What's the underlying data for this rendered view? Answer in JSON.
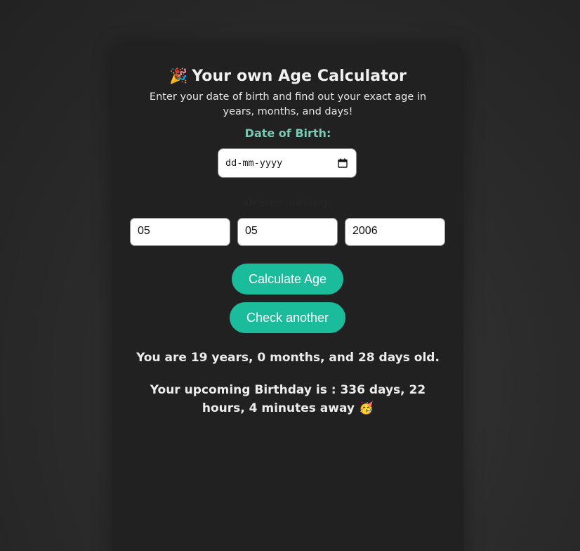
{
  "header": {
    "emoji": "🎉",
    "title": "Your own Age Calculator",
    "subtitle": "Enter your date of birth and find out your exact age in years, months, and days!"
  },
  "dob": {
    "label": "Date of Birth:",
    "placeholder": "dd-mm-yyyy",
    "calendar_icon": "calendar-icon"
  },
  "manual": {
    "label": "Or enter manually:",
    "day": "05",
    "month": "05",
    "year": "2006"
  },
  "buttons": {
    "calculate": "Calculate Age",
    "check_another": "Check another"
  },
  "results": {
    "age": "You are 19 years, 0 months, and 28 days old.",
    "birthday": "Your upcoming Birthday is : 336 days, 22 hours, 4 minutes away",
    "birthday_emoji": "🥳"
  },
  "colors": {
    "accent": "#1abc9c",
    "label": "#7cc8b6",
    "card": "#212121"
  }
}
